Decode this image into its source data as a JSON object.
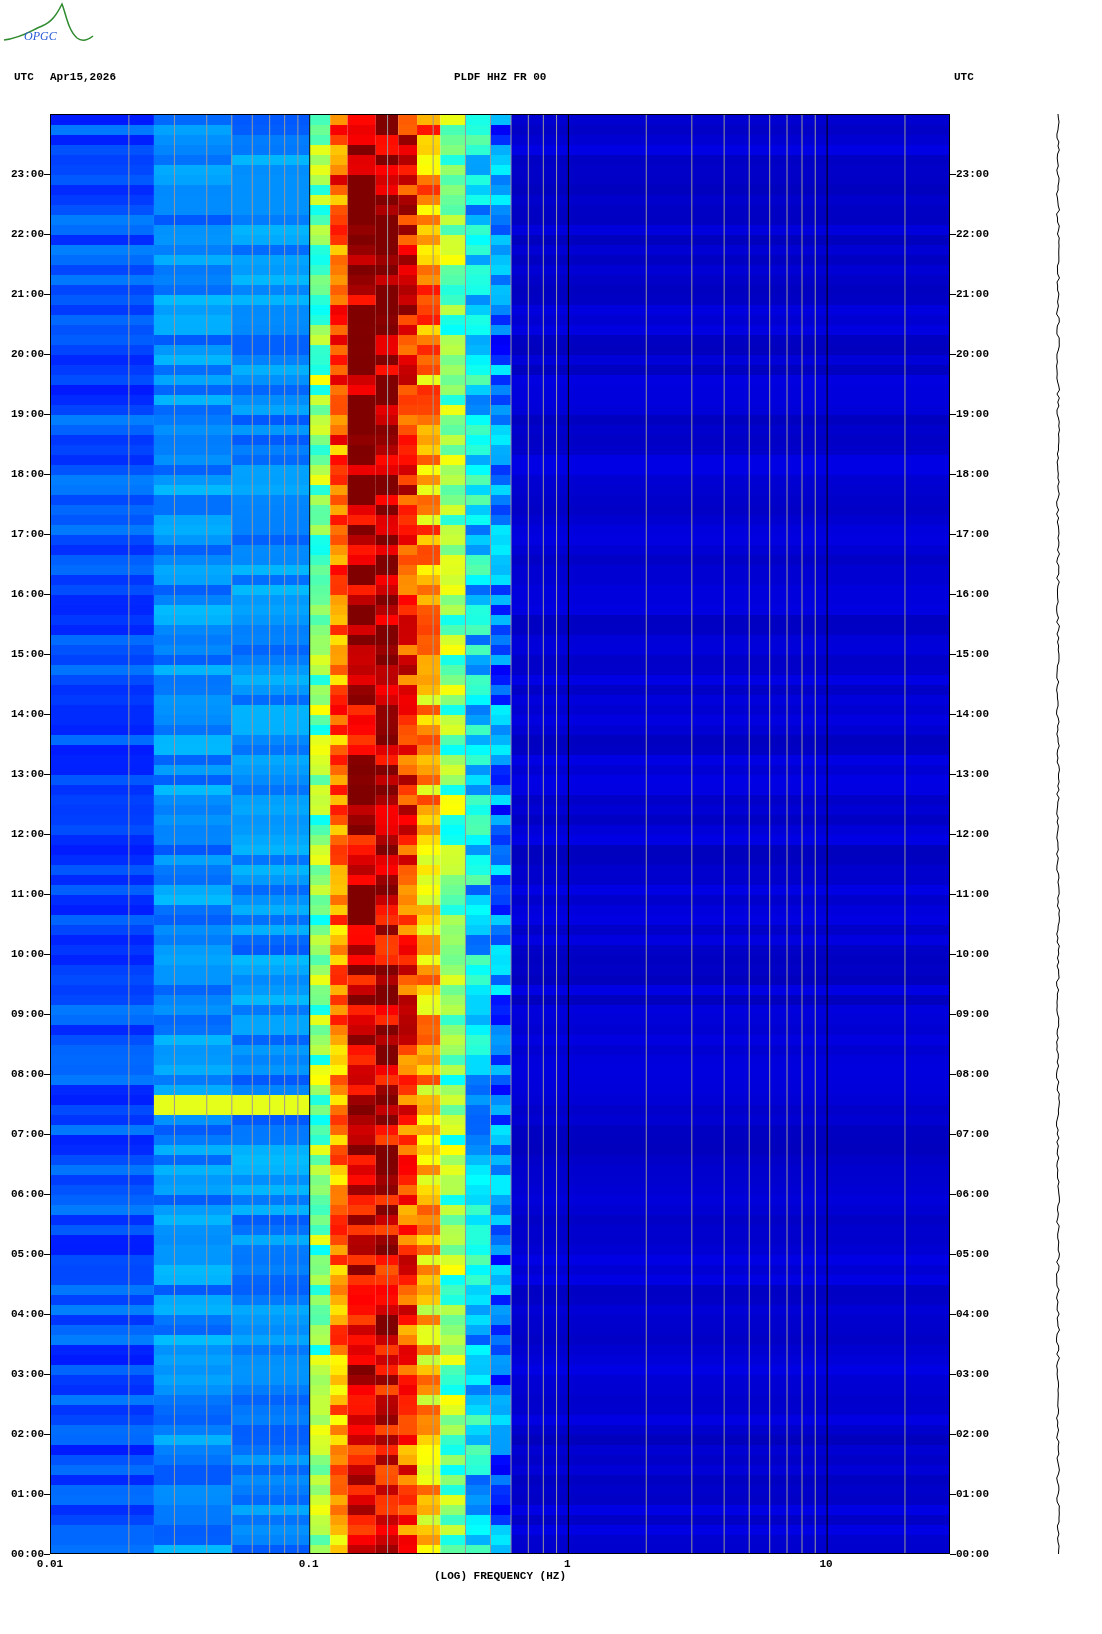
{
  "header": {
    "logo_text": "OPGC",
    "left_timezone": "UTC",
    "date": "Apr15,2026",
    "station": "PLDF HHZ FR 00",
    "right_timezone": "UTC"
  },
  "plot": {
    "y_ticks_left": [
      "23:00",
      "22:00",
      "21:00",
      "20:00",
      "19:00",
      "18:00",
      "17:00",
      "16:00",
      "15:00",
      "14:00",
      "13:00",
      "12:00",
      "11:00",
      "10:00",
      "09:00",
      "08:00",
      "07:00",
      "06:00",
      "05:00",
      "04:00",
      "03:00",
      "02:00",
      "01:00",
      "00:00"
    ],
    "y_ticks_right": [
      "23:00",
      "22:00",
      "21:00",
      "20:00",
      "19:00",
      "18:00",
      "17:00",
      "16:00",
      "15:00",
      "14:00",
      "13:00",
      "12:00",
      "11:00",
      "10:00",
      "09:00",
      "08:00",
      "07:00",
      "06:00",
      "05:00",
      "04:00",
      "03:00",
      "02:00",
      "01:00",
      "00:00"
    ],
    "x_ticks": [
      "0.01",
      "0.1",
      "1",
      "10"
    ],
    "xlabel": "(LOG) FREQUENCY (HZ)"
  }
}
